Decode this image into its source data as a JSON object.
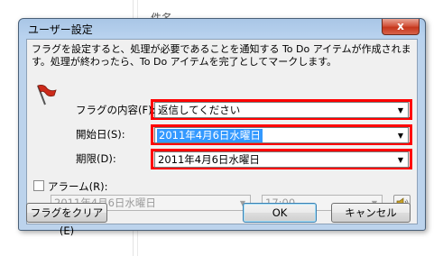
{
  "background": {
    "fragment_text": "件名"
  },
  "dialog": {
    "title": "ユーザー設定",
    "close_label": "x",
    "message": "フラグを設定すると、処理が必要であることを通知する To Do アイテムが作成されます。処理が終わったら、To Do アイテムを完了としてマークします。",
    "flag_content_label": "フラグの内容(F):",
    "flag_content_value": "返信してください",
    "start_date_label": "開始日(S):",
    "start_date_value": "2011年4月6日水曜日",
    "due_date_label": "期限(D):",
    "due_date_value": "2011年4月6日水曜日",
    "alarm_label": "アラーム(R):",
    "alarm_checked": false,
    "alarm_date_value": "2011年4月6日水曜日",
    "alarm_time_value": "17:00",
    "clear_flag_button": "フラグをクリア(E)",
    "ok_button": "OK",
    "cancel_button": "キャンセル"
  },
  "colors": {
    "highlight_box": "#ff0000",
    "selection": "#3399ff",
    "flag": "#cc2a1a"
  }
}
